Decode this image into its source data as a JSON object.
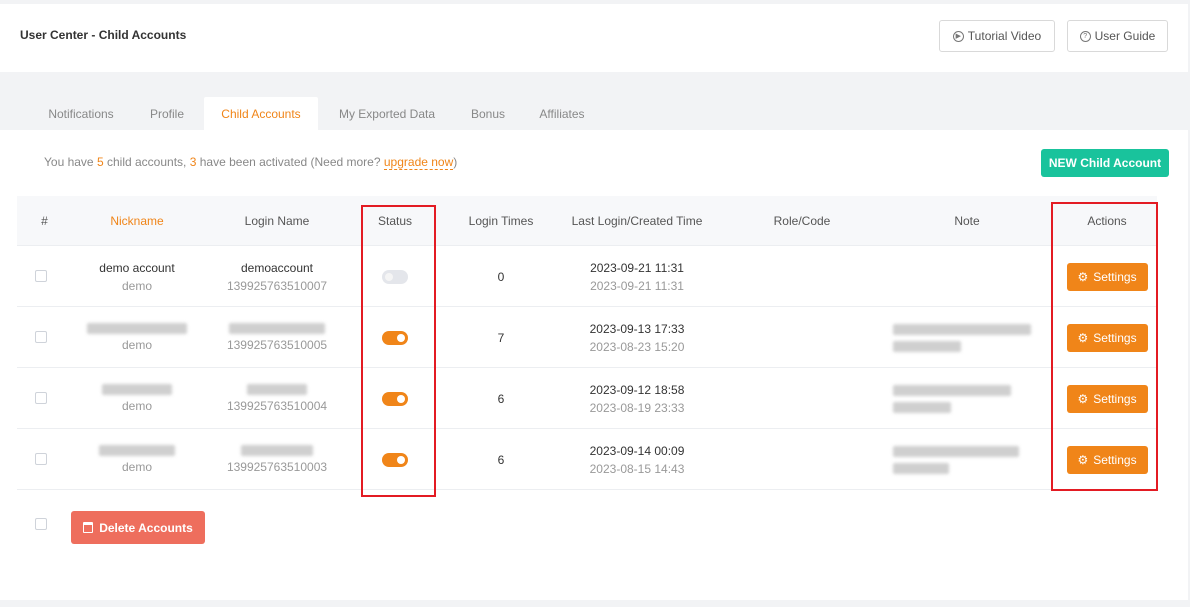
{
  "header": {
    "title": "User Center - Child Accounts",
    "tutorial_label": "Tutorial Video",
    "tutorial_icon": "play-circle-icon",
    "guide_label": "User Guide",
    "guide_icon": "question-circle-icon"
  },
  "tabs": [
    {
      "label": "Notifications"
    },
    {
      "label": "Profile"
    },
    {
      "label": "Child Accounts",
      "active": true
    },
    {
      "label": "My Exported Data"
    },
    {
      "label": "Bonus"
    },
    {
      "label": "Affiliates"
    }
  ],
  "info": {
    "prefix": "You have",
    "child_count": "5",
    "middle": "child accounts,",
    "activated_count": "3",
    "suffix": "have been activated (Need more?",
    "link": "upgrade now",
    "close": ")"
  },
  "new_button": "NEW Child Account",
  "table": {
    "headers": [
      "#",
      "Nickname",
      "Login Name",
      "Status",
      "Login Times",
      "Last Login/Created Time",
      "Role/Code",
      "Note",
      "Actions"
    ],
    "rows": [
      {
        "nickname": "demo account",
        "nickname_sub": "demo",
        "login": "demoaccount",
        "login_sub": "139925763510007",
        "status": "off",
        "times": "0",
        "last_login": "2023-09-21 11:31",
        "created": "2023-09-21 11:31",
        "role": "",
        "note": "",
        "action": "Settings"
      },
      {
        "nickname": "",
        "nickname_sub": "demo",
        "login": "",
        "login_sub": "139925763510005",
        "status": "on",
        "times": "7",
        "last_login": "2023-09-13 17:33",
        "created": "2023-08-23 15:20",
        "role": "",
        "note": "",
        "action": "Settings"
      },
      {
        "nickname": "",
        "nickname_sub": "demo",
        "login": "",
        "login_sub": "139925763510004",
        "status": "on",
        "times": "6",
        "last_login": "2023-09-12 18:58",
        "created": "2023-08-19 23:33",
        "role": "",
        "note": "",
        "action": "Settings"
      },
      {
        "nickname": "",
        "nickname_sub": "demo",
        "login": "",
        "login_sub": "139925763510003",
        "status": "on",
        "times": "6",
        "last_login": "2023-09-14 00:09",
        "created": "2023-08-15 14:43",
        "role": "",
        "note": "",
        "action": "Settings"
      }
    ]
  },
  "delete_button": "Delete Accounts",
  "colors": {
    "accent": "#f08519",
    "new_button": "#19c39c",
    "delete_button": "#ee6e5d",
    "highlight": "#e31b23"
  }
}
